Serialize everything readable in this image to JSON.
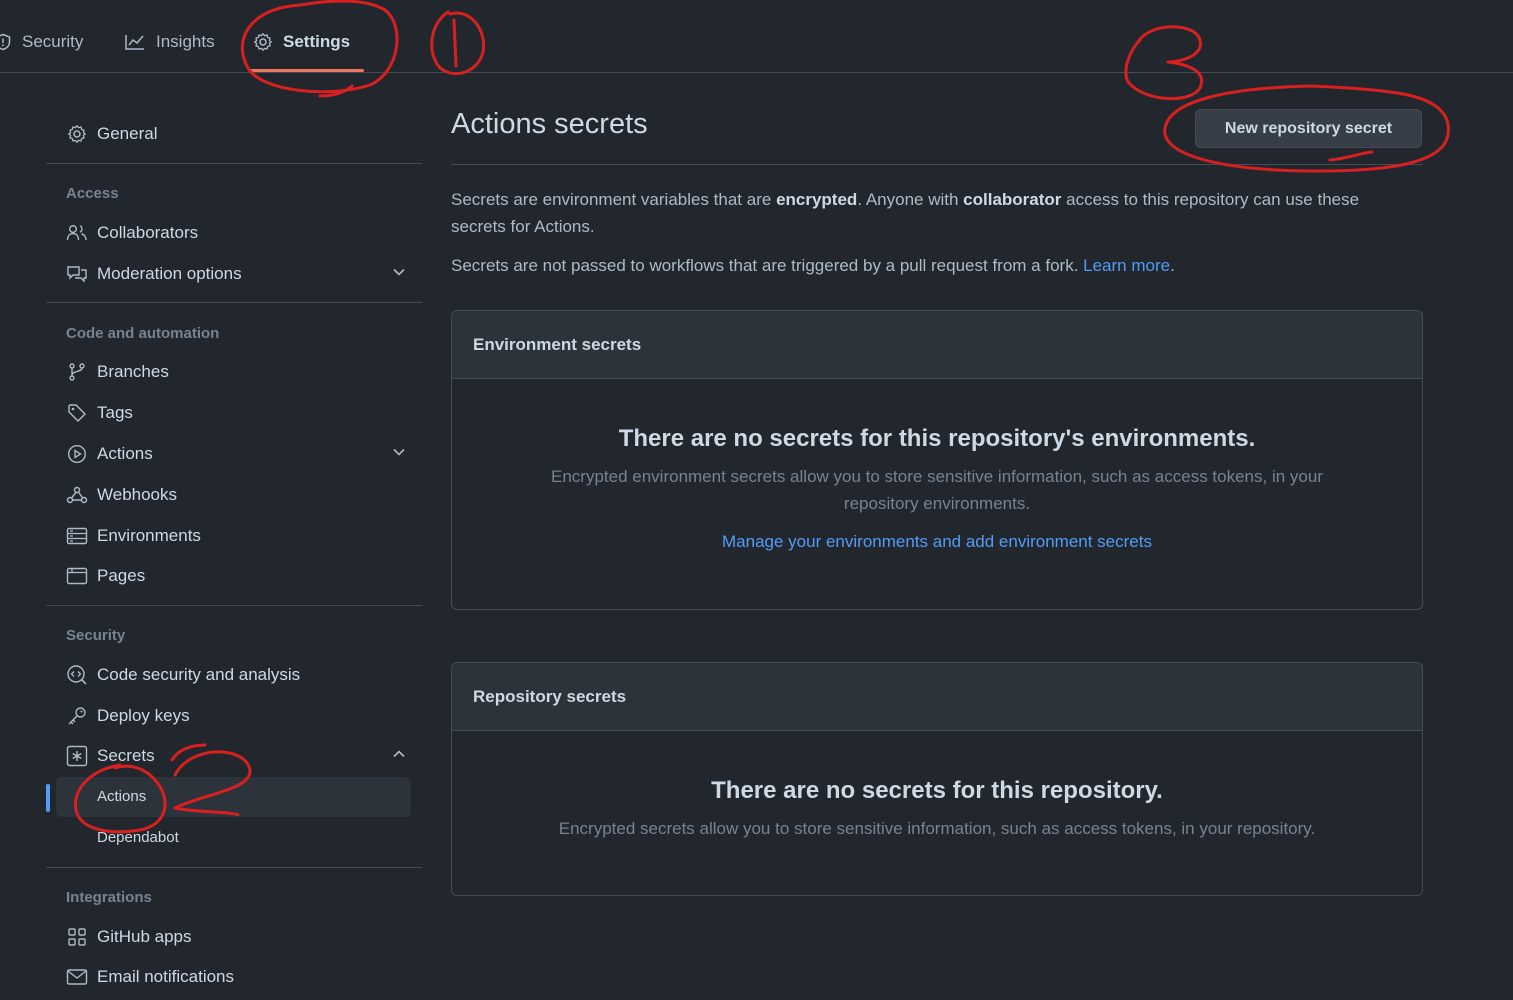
{
  "topnav": {
    "tabs": [
      {
        "label": "Security",
        "icon": "shield-icon"
      },
      {
        "label": "Insights",
        "icon": "graph-icon"
      },
      {
        "label": "Settings",
        "icon": "gear-icon",
        "selected": true
      }
    ]
  },
  "sidebar": {
    "general": "General",
    "sections": {
      "access": {
        "heading": "Access",
        "items": [
          {
            "label": "Collaborators",
            "icon": "people-icon"
          },
          {
            "label": "Moderation options",
            "icon": "comment-discussion-icon",
            "expandable": true
          }
        ]
      },
      "code_automation": {
        "heading": "Code and automation",
        "items": [
          {
            "label": "Branches",
            "icon": "git-branch-icon"
          },
          {
            "label": "Tags",
            "icon": "tag-icon"
          },
          {
            "label": "Actions",
            "icon": "play-icon",
            "expandable": true
          },
          {
            "label": "Webhooks",
            "icon": "webhook-icon"
          },
          {
            "label": "Environments",
            "icon": "server-icon"
          },
          {
            "label": "Pages",
            "icon": "browser-icon"
          }
        ]
      },
      "security": {
        "heading": "Security",
        "items": [
          {
            "label": "Code security and analysis",
            "icon": "codescan-icon"
          },
          {
            "label": "Deploy keys",
            "icon": "key-icon"
          },
          {
            "label": "Secrets",
            "icon": "key-asterisk-icon",
            "expanded": true
          }
        ],
        "secrets_sub": [
          "Actions",
          "Dependabot"
        ]
      },
      "integrations": {
        "heading": "Integrations",
        "items": [
          {
            "label": "GitHub apps",
            "icon": "apps-icon"
          },
          {
            "label": "Email notifications",
            "icon": "mail-icon"
          }
        ]
      }
    }
  },
  "main": {
    "title": "Actions secrets",
    "new_button": "New repository secret",
    "intro": {
      "p1_a": "Secrets are environment variables that are ",
      "p1_b": "encrypted",
      "p1_c": ". Anyone with ",
      "p1_d": "collaborator",
      "p1_e": " access to this repository can use these secrets for Actions.",
      "p2_a": "Secrets are not passed to workflows that are triggered by a pull request from a fork. ",
      "p2_link": "Learn more",
      "p2_end": "."
    },
    "env_box": {
      "header": "Environment secrets",
      "title": "There are no secrets for this repository's environments.",
      "desc": "Encrypted environment secrets allow you to store sensitive information, such as access tokens, in your repository environments.",
      "link": "Manage your environments and add environment secrets"
    },
    "repo_box": {
      "header": "Repository secrets",
      "title": "There are no secrets for this repository.",
      "desc": "Encrypted secrets allow you to store sensitive information, such as access tokens, in your repository."
    }
  },
  "annotations": {
    "color": "#d92020",
    "steps": [
      "1",
      "2",
      "3"
    ]
  },
  "colors": {
    "background": "#22272e",
    "accent": "#539bf5",
    "tab_underline": "#ec775c"
  }
}
